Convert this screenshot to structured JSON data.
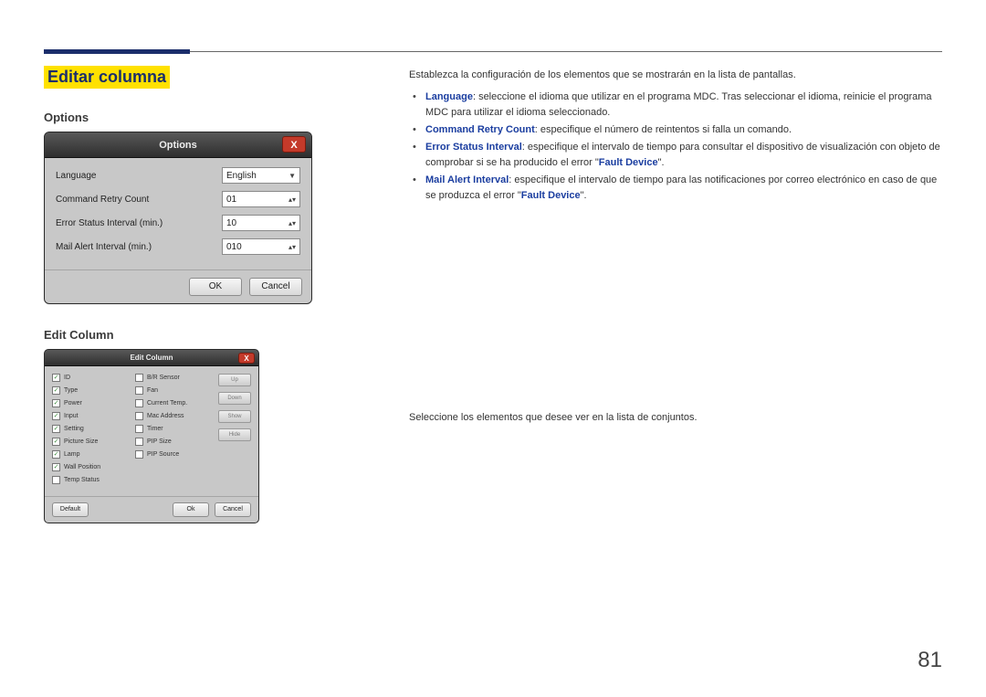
{
  "header": {
    "section_title": "Editar columna"
  },
  "left": {
    "options_heading": "Options",
    "options_dialog": {
      "title": "Options",
      "close": "X",
      "rows": {
        "language_label": "Language",
        "language_value": "English",
        "retry_label": "Command Retry Count",
        "retry_value": "01",
        "error_interval_label": "Error Status Interval (min.)",
        "error_interval_value": "10",
        "mail_interval_label": "Mail Alert Interval (min.)",
        "mail_interval_value": "010"
      },
      "ok": "OK",
      "cancel": "Cancel"
    },
    "editcol_heading": "Edit Column",
    "editcol_dialog": {
      "title": "Edit Column",
      "close": "X",
      "col1": [
        {
          "label": "ID",
          "checked": true
        },
        {
          "label": "Type",
          "checked": true
        },
        {
          "label": "Power",
          "checked": true
        },
        {
          "label": "Input",
          "checked": true
        },
        {
          "label": "Setting",
          "checked": true
        },
        {
          "label": "Picture Size",
          "checked": true
        },
        {
          "label": "Lamp",
          "checked": true
        },
        {
          "label": "Wall Position",
          "checked": true
        },
        {
          "label": "Temp Status",
          "checked": false
        }
      ],
      "col2": [
        {
          "label": "B/R Sensor",
          "checked": false
        },
        {
          "label": "Fan",
          "checked": false
        },
        {
          "label": "Current Temp.",
          "checked": false
        },
        {
          "label": "Mac Address",
          "checked": false
        },
        {
          "label": "Timer",
          "checked": false
        },
        {
          "label": "PIP Size",
          "checked": false
        },
        {
          "label": "PIP Source",
          "checked": false
        }
      ],
      "side_buttons": [
        "Up",
        "Down",
        "Show",
        "Hide"
      ],
      "default": "Default",
      "ok": "Ok",
      "cancel": "Cancel"
    }
  },
  "right": {
    "intro1": "Establezca la configuración de los elementos que se mostrarán en la lista de pantallas.",
    "b1_term": "Language",
    "b1_text": ": seleccione el idioma que utilizar en el programa MDC. Tras seleccionar el idioma, reinicie el programa MDC para utilizar el idioma seleccionado.",
    "b2_term": "Command Retry Count",
    "b2_text": ": especifique el número de reintentos si falla un comando.",
    "b3_term": "Error Status Interval",
    "b3_text_a": ": especifique el intervalo de tiempo para consultar el dispositivo de visualización con objeto de comprobar si se ha producido el error \"",
    "b3_quoted": "Fault Device",
    "b3_text_b": "\".",
    "b4_term": "Mail Alert Interval",
    "b4_text_a": ": especifique el intervalo de tiempo para las notificaciones por correo electrónico en caso de que se produzca el error \"",
    "b4_quoted": "Fault Device",
    "b4_text_b": "\".",
    "intro2": "Seleccione los elementos que desee ver en la lista de conjuntos."
  },
  "page_number": "81"
}
